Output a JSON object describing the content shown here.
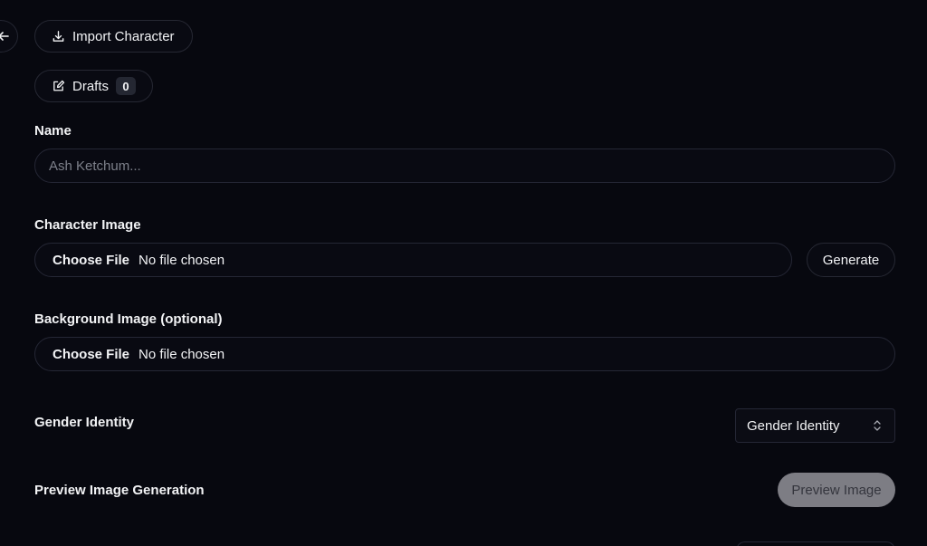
{
  "actions": {
    "import_character": "Import Character",
    "drafts_label": "Drafts",
    "drafts_count": "0"
  },
  "form": {
    "name": {
      "label": "Name",
      "placeholder": "Ash Ketchum..."
    },
    "character_image": {
      "label": "Character Image",
      "choose_label": "Choose File",
      "file_status": "No file chosen",
      "generate_label": "Generate"
    },
    "background_image": {
      "label": "Background Image (optional)",
      "choose_label": "Choose File",
      "file_status": "No file chosen"
    },
    "gender_identity": {
      "label": "Gender Identity",
      "selected": "Gender Identity"
    },
    "preview_generation": {
      "label": "Preview Image Generation",
      "button_label": "Preview Image"
    }
  },
  "icons": {
    "back": "arrow-left-icon",
    "import": "download-icon",
    "drafts": "edit-icon",
    "select": "chevron-up-down-icon"
  },
  "colors": {
    "background": "#07080f",
    "border": "#252735",
    "text": "#f2f3f5",
    "muted_text": "#7d808a",
    "disabled_button": "#7d7d84"
  }
}
